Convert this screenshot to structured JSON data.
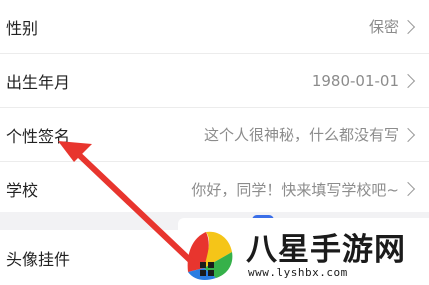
{
  "profile": {
    "rows": [
      {
        "label": "性别",
        "value": "保密"
      },
      {
        "label": "出生年月",
        "value": "1980-01-01"
      },
      {
        "label": "个性签名",
        "value": "这个人很神秘，什么都没有写"
      },
      {
        "label": "学校",
        "value": "你好，同学！快来填写学校吧~"
      }
    ],
    "avatar_row": {
      "label": "头像挂件"
    }
  },
  "watermark": {
    "title": "八星手游网",
    "url": "www.lyshbx.com"
  },
  "annotation": {
    "arrow_color": "#e8352e"
  },
  "icons": [
    "chevron-right-icon",
    "logo-icon",
    "red-arrow"
  ]
}
